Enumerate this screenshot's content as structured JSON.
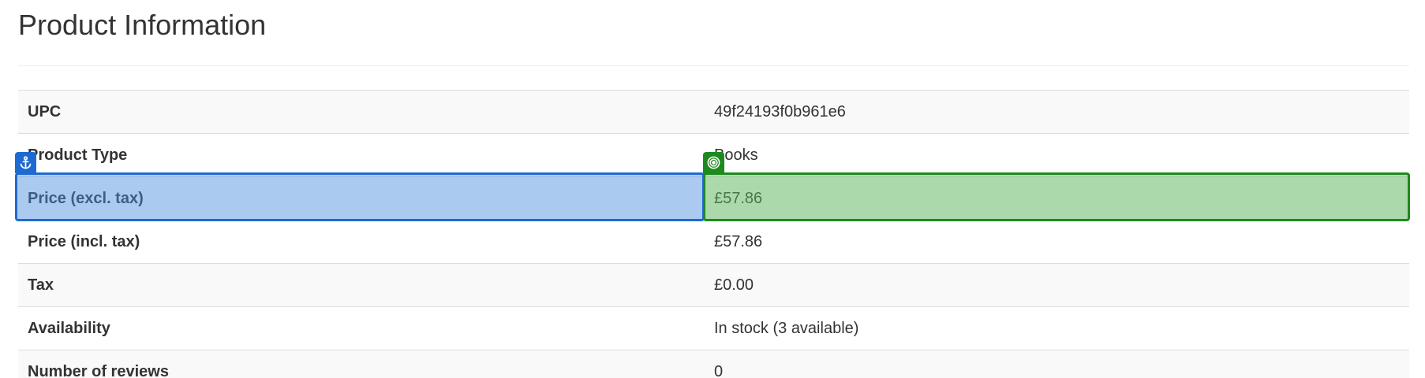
{
  "page": {
    "title": "Product Information"
  },
  "product_table": {
    "rows": [
      {
        "label": "UPC",
        "value": "49f24193f0b961e6"
      },
      {
        "label": "Product Type",
        "value": "Books"
      },
      {
        "label": "Price (excl. tax)",
        "value": "£57.86"
      },
      {
        "label": "Price (incl. tax)",
        "value": "£57.86"
      },
      {
        "label": "Tax",
        "value": "£0.00"
      },
      {
        "label": "Availability",
        "value": "In stock (3 available)"
      },
      {
        "label": "Number of reviews",
        "value": "0"
      }
    ]
  },
  "highlights": {
    "anchor": {
      "icon": "anchor-icon",
      "color": "#1f6ad1"
    },
    "target": {
      "icon": "target-icon",
      "color": "#1e8a1e"
    }
  }
}
